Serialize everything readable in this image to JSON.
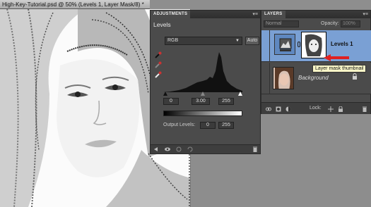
{
  "document": {
    "tab_title": "High-Key-Tutorial.psd @ 50% (Levels 1, Layer Mask/8) *"
  },
  "adjustments_panel": {
    "tab_label": "ADJUSTMENTS",
    "title": "Levels",
    "channel_select": "RGB",
    "auto_label": "Auto",
    "input_black": "0",
    "input_gamma": "3.00",
    "input_white": "255",
    "output_label": "Output Levels:",
    "output_black": "0",
    "output_white": "255",
    "eyedropper_icons": [
      "black-point-eyedropper",
      "gray-point-eyedropper",
      "white-point-eyedropper"
    ]
  },
  "layers_panel": {
    "tab_label": "LAYERS",
    "blend_mode": "Normal",
    "opacity_label": "Opacity:",
    "opacity_value": "100%",
    "layers": [
      {
        "name": "Levels 1",
        "selected": true
      },
      {
        "name": "Background",
        "selected": false
      }
    ],
    "lock_label": "Lock:",
    "tooltip": "Layer mask thumbnail"
  },
  "colors": {
    "panel_bg": "#4b4b4b",
    "selected_layer": "#7aa0d4",
    "annotation_arrow": "#e02020"
  }
}
